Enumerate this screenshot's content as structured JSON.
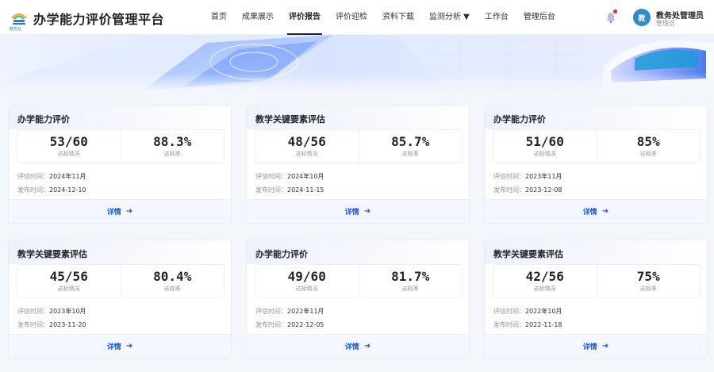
{
  "header": {
    "logo_text": "教务处",
    "title": "办学能力评价管理平台",
    "nav": [
      {
        "label": "首页",
        "active": false
      },
      {
        "label": "成果展示",
        "active": false
      },
      {
        "label": "评价报告",
        "active": true
      },
      {
        "label": "评价迎检",
        "active": false
      },
      {
        "label": "资料下载",
        "active": false
      },
      {
        "label": "监测分析 ▼",
        "active": false
      },
      {
        "label": "工作台",
        "active": false
      },
      {
        "label": "管理后台",
        "active": false
      }
    ],
    "user": {
      "avatar": "教",
      "name": "教务处管理员",
      "role": "管理员"
    },
    "icons": {
      "notify": "bell-icon"
    }
  },
  "labels": {
    "status": "达标情况",
    "rate": "达标率",
    "eval_time": "评估时间：",
    "publish_time": "发布时间：",
    "detail": "详情",
    "detail_arrow": "➜"
  },
  "colors": {
    "accent": "#1f5bd8",
    "avatar": "#2c8ec6"
  },
  "cards": [
    {
      "title": "办学能力评价",
      "score": "53/60",
      "rate": "88.3%",
      "eval": "2024年11月",
      "publish": "2024-12-10"
    },
    {
      "title": "教学关键要素评估",
      "score": "48/56",
      "rate": "85.7%",
      "eval": "2024年10月",
      "publish": "2024-11-15"
    },
    {
      "title": "办学能力评价",
      "score": "51/60",
      "rate": "85%",
      "eval": "2023年11月",
      "publish": "2023-12-08"
    },
    {
      "title": "教学关键要素评估",
      "score": "45/56",
      "rate": "80.4%",
      "eval": "2023年10月",
      "publish": "2023-11-20"
    },
    {
      "title": "办学能力评价",
      "score": "49/60",
      "rate": "81.7%",
      "eval": "2022年11月",
      "publish": "2022-12-05"
    },
    {
      "title": "教学关键要素评估",
      "score": "42/56",
      "rate": "75%",
      "eval": "2022年10月",
      "publish": "2022-11-18"
    }
  ]
}
